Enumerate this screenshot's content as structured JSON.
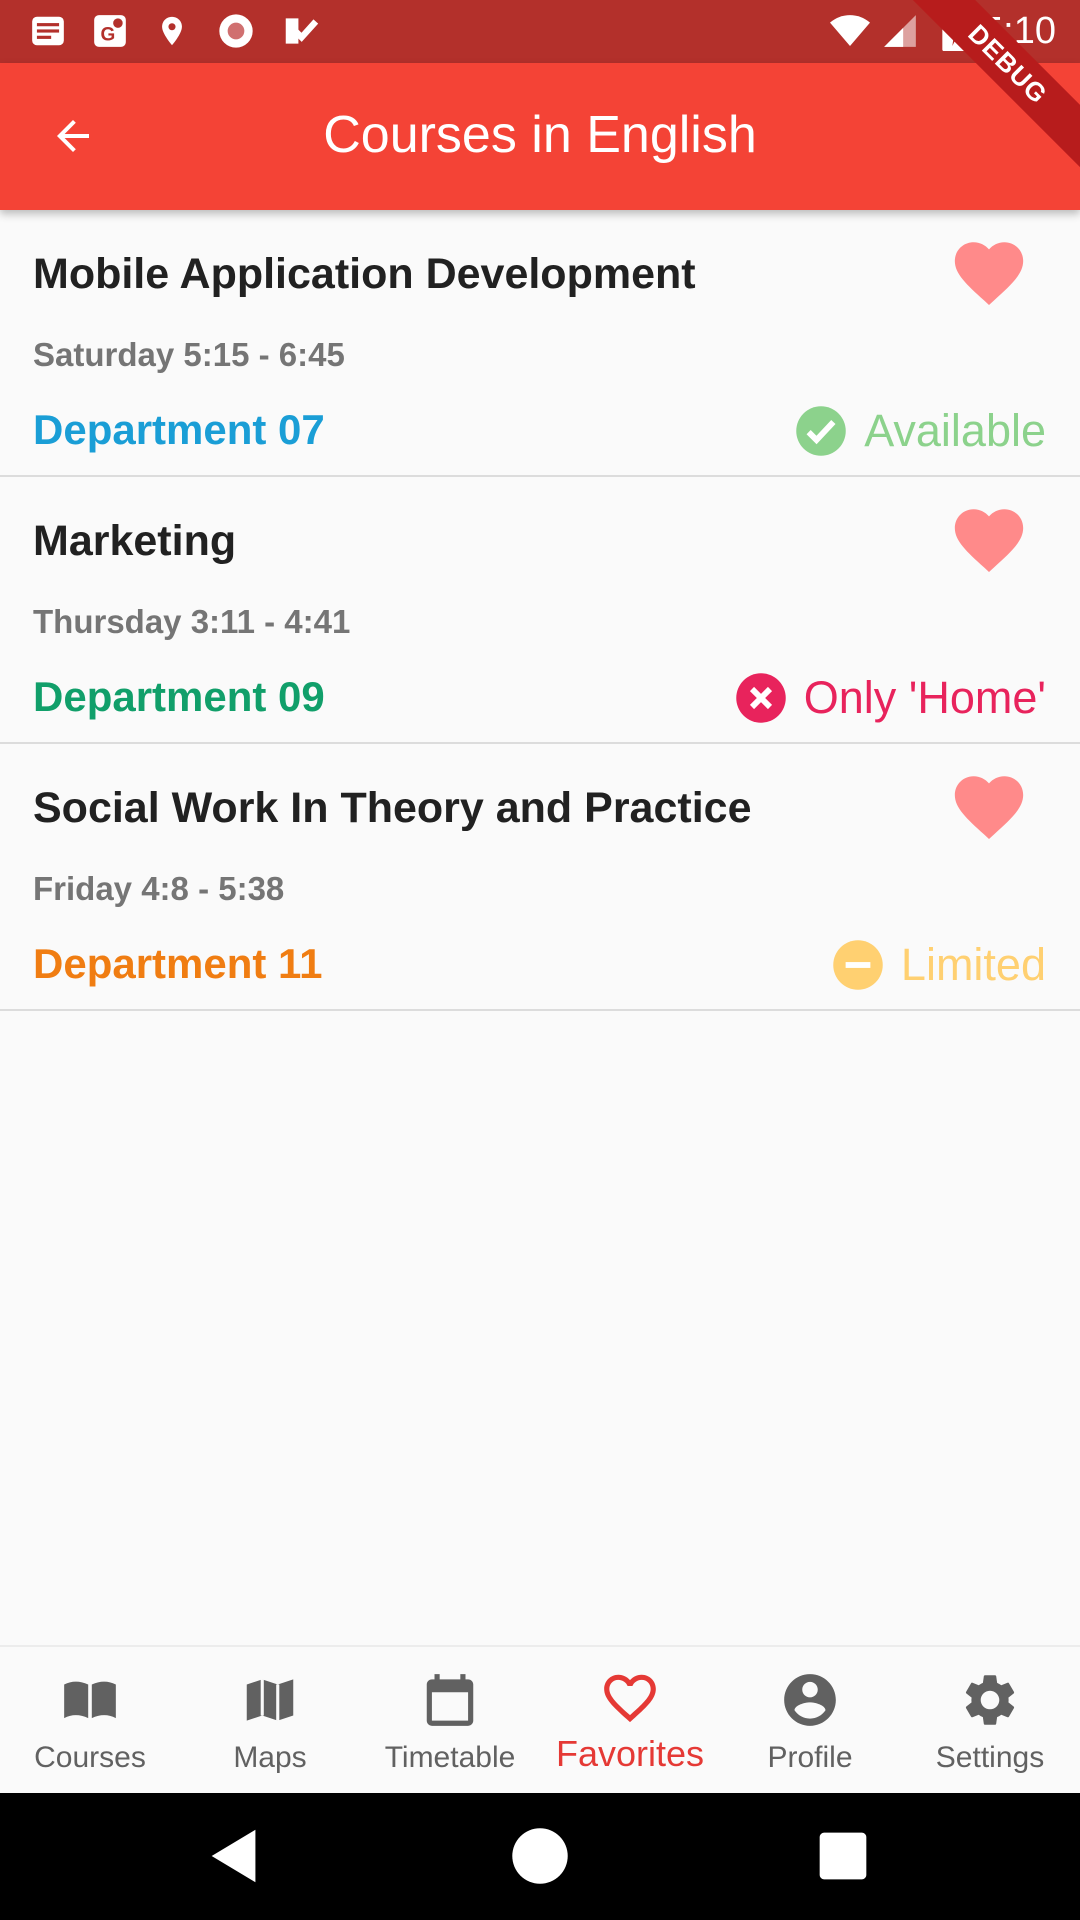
{
  "status_bar": {
    "time": "5:10",
    "icons": [
      "news-icon",
      "maps-app-icon",
      "location-pin-icon",
      "record-icon",
      "task-check-icon",
      "wifi-icon",
      "cell-signal-icon",
      "battery-charging-icon"
    ]
  },
  "app_bar": {
    "title": "Courses in English",
    "back_icon": "arrow-back-icon"
  },
  "debug_banner": "DEBUG",
  "courses": [
    {
      "title": "Mobile Application Development",
      "time": "Saturday 5:15 - 6:45",
      "department": "Department 07",
      "department_color": "#1a9ed6",
      "status": "Available",
      "status_color": "#8cd28c",
      "status_icon": "check-circle-icon",
      "favorite": true
    },
    {
      "title": "Marketing",
      "time": "Thursday 3:11  - 4:41",
      "department": "Department 09",
      "department_color": "#119f6a",
      "status": "Only 'Home'",
      "status_color": "#e8235c",
      "status_icon": "cancel-circle-icon",
      "favorite": true
    },
    {
      "title": "Social Work In Theory and Practice",
      "time": "Friday 4:8 -  5:38",
      "department": "Department 11",
      "department_color": "#f07d12",
      "status": "Limited",
      "status_color": "#ffd071",
      "status_icon": "minus-circle-icon",
      "favorite": true
    }
  ],
  "favorite_color": "#ff8a8a",
  "bottom_nav": {
    "active_index": 3,
    "active_color": "#e53935",
    "items": [
      {
        "label": "Courses",
        "icon": "book-icon"
      },
      {
        "label": "Maps",
        "icon": "map-icon"
      },
      {
        "label": "Timetable",
        "icon": "calendar-icon"
      },
      {
        "label": "Favorites",
        "icon": "heart-outline-icon"
      },
      {
        "label": "Profile",
        "icon": "account-circle-icon"
      },
      {
        "label": "Settings",
        "icon": "gear-icon"
      }
    ]
  },
  "system_nav": [
    "back-triangle-icon",
    "home-circle-icon",
    "recents-square-icon"
  ]
}
